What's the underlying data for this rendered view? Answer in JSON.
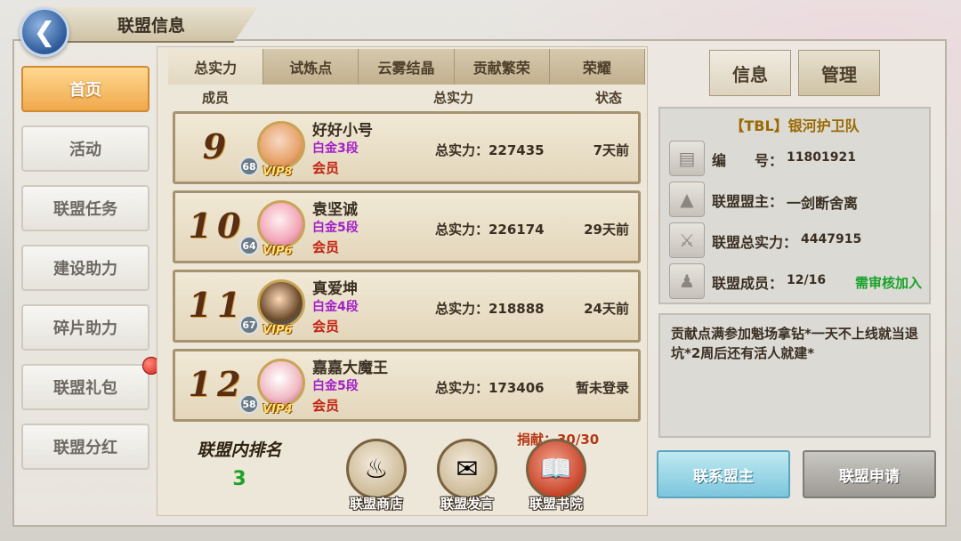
{
  "header": {
    "title": "联盟信息"
  },
  "nav": {
    "items": [
      {
        "label": "首页",
        "active": true
      },
      {
        "label": "活动"
      },
      {
        "label": "联盟任务"
      },
      {
        "label": "建设助力"
      },
      {
        "label": "碎片助力"
      },
      {
        "label": "联盟礼包",
        "badge": true
      },
      {
        "label": "联盟分红"
      }
    ]
  },
  "tabs": [
    "总实力",
    "试炼点",
    "云雾结晶",
    "贡献繁荣",
    "荣耀"
  ],
  "columns": {
    "member": "成员",
    "power": "总实力",
    "status": "状态"
  },
  "members": [
    {
      "rank": "9",
      "level": "68",
      "vip": "VIP8",
      "name": "好好小号",
      "grade": "白金3段",
      "role": "会员",
      "power": "总实力：227435",
      "status": "7天前"
    },
    {
      "rank": "10",
      "level": "64",
      "vip": "VIP6",
      "name": "袁坚诚",
      "grade": "白金5段",
      "role": "会员",
      "power": "总实力：226174",
      "status": "29天前"
    },
    {
      "rank": "11",
      "level": "67",
      "vip": "VIP6",
      "name": "真爱坤",
      "grade": "白金4段",
      "role": "会员",
      "power": "总实力：218888",
      "status": "24天前"
    },
    {
      "rank": "12",
      "level": "58",
      "vip": "VIP4",
      "name": "嘉嘉大魔王",
      "grade": "白金5段",
      "role": "会员",
      "power": "总实力：173406",
      "status": "暂未登录"
    }
  ],
  "bottom": {
    "ranking_title": "联盟内排名",
    "ranking_value": "3",
    "donation": "捐献：30/30",
    "features": [
      {
        "label": "联盟商店",
        "icon": "pot-icon"
      },
      {
        "label": "联盟发言",
        "icon": "chat-icon"
      },
      {
        "label": "联盟书院",
        "icon": "book-icon"
      }
    ]
  },
  "right": {
    "tabs": [
      "信息",
      "管理"
    ],
    "alliance_name": "【TBL】银河护卫队",
    "info": [
      {
        "label": "编　　号：",
        "value": "11801921",
        "icon": "id-icon"
      },
      {
        "label": "联盟盟主：",
        "value": "一剑断舍离",
        "icon": "hat-icon"
      },
      {
        "label": "联盟总实力：",
        "value": "4447915",
        "icon": "swords-icon"
      },
      {
        "label": "联盟成员：",
        "value": "12/16",
        "badge": "需审核加入",
        "icon": "members-icon"
      }
    ],
    "announcement": "贡献点满参加魁场拿钻*一天不上线就当退坑*2周后还有活人就建*",
    "buttons": {
      "contact": "联系盟主",
      "apply": "联盟申请"
    }
  }
}
